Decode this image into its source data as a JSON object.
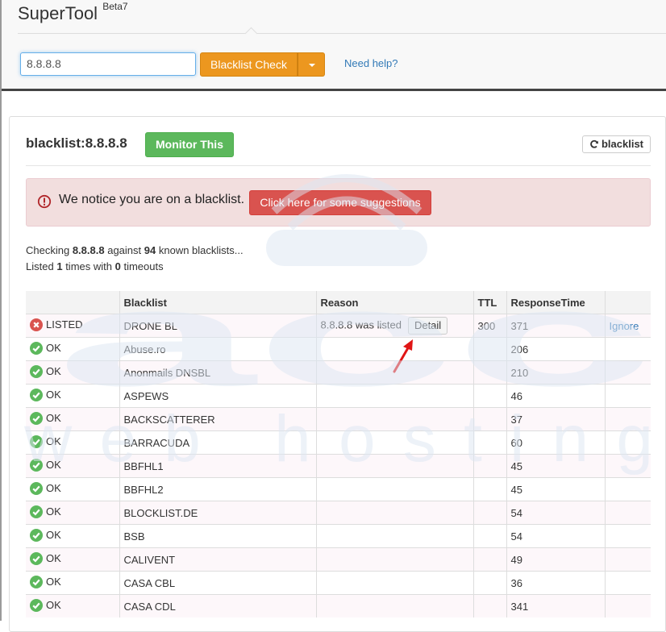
{
  "app": {
    "name": "SuperTool",
    "version": "Beta7"
  },
  "search": {
    "value": "8.8.8.8",
    "button_label": "Blacklist Check",
    "help_link": "Need help?"
  },
  "result": {
    "title": "blacklist:8.8.8.8",
    "monitor_label": "Monitor This",
    "refresh_label": "blacklist",
    "alert_text": "We notice you are on a blacklist.",
    "suggest_label": "Click here for some suggestions",
    "checking": {
      "prefix": "Checking",
      "ip": "8.8.8.8",
      "against": "against",
      "count": "94",
      "suffix": "known blacklists..."
    },
    "listed": {
      "prefix": "Listed",
      "times": "1",
      "mid": "times with",
      "timeouts": "0",
      "suffix": "timeouts"
    }
  },
  "table": {
    "headers": [
      "",
      "Blacklist",
      "Reason",
      "TTL",
      "ResponseTime",
      ""
    ],
    "rows": [
      {
        "status": "LISTED",
        "state": "error",
        "blacklist": "DRONE BL",
        "reason": "8.8.8.8 was listed",
        "detail": "Detail",
        "ttl": "300",
        "response": "371",
        "action": "Ignore"
      },
      {
        "status": "OK",
        "state": "ok",
        "blacklist": "Abuse.ro",
        "reason": "",
        "ttl": "",
        "response": "206",
        "action": ""
      },
      {
        "status": "OK",
        "state": "ok",
        "blacklist": "Anonmails DNSBL",
        "reason": "",
        "ttl": "",
        "response": "210",
        "action": ""
      },
      {
        "status": "OK",
        "state": "ok",
        "blacklist": "ASPEWS",
        "reason": "",
        "ttl": "",
        "response": "46",
        "action": ""
      },
      {
        "status": "OK",
        "state": "ok",
        "blacklist": "BACKSCATTERER",
        "reason": "",
        "ttl": "",
        "response": "37",
        "action": ""
      },
      {
        "status": "OK",
        "state": "ok",
        "blacklist": "BARRACUDA",
        "reason": "",
        "ttl": "",
        "response": "60",
        "action": ""
      },
      {
        "status": "OK",
        "state": "ok",
        "blacklist": "BBFHL1",
        "reason": "",
        "ttl": "",
        "response": "45",
        "action": ""
      },
      {
        "status": "OK",
        "state": "ok",
        "blacklist": "BBFHL2",
        "reason": "",
        "ttl": "",
        "response": "45",
        "action": ""
      },
      {
        "status": "OK",
        "state": "ok",
        "blacklist": "BLOCKLIST.DE",
        "reason": "",
        "ttl": "",
        "response": "54",
        "action": ""
      },
      {
        "status": "OK",
        "state": "ok",
        "blacklist": "BSB",
        "reason": "",
        "ttl": "",
        "response": "54",
        "action": ""
      },
      {
        "status": "OK",
        "state": "ok",
        "blacklist": "CALIVENT",
        "reason": "",
        "ttl": "",
        "response": "49",
        "action": ""
      },
      {
        "status": "OK",
        "state": "ok",
        "blacklist": "CASA CBL",
        "reason": "",
        "ttl": "",
        "response": "36",
        "action": ""
      },
      {
        "status": "OK",
        "state": "ok",
        "blacklist": "CASA CDL",
        "reason": "",
        "ttl": "",
        "response": "341",
        "action": ""
      }
    ]
  },
  "watermark": {
    "top": "acc",
    "bottom": "web hosting"
  },
  "colors": {
    "ok": "#5cb85c",
    "error": "#d9534f",
    "warning": "#ec971f",
    "link": "#337ab7",
    "watermark": "#dde7f3"
  },
  "icons": {
    "ok": "check-circle-icon",
    "error": "times-circle-icon",
    "alert": "exclamation-circle-icon",
    "refresh": "refresh-icon",
    "caret": "caret-down-icon",
    "arrow": "red-arrow-icon"
  }
}
